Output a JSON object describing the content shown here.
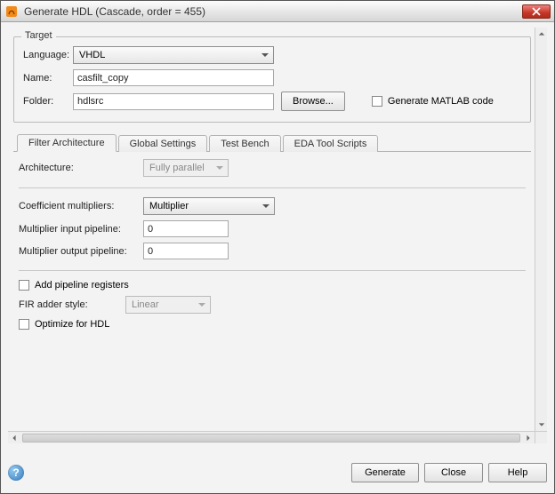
{
  "window": {
    "title": "Generate HDL (Cascade, order = 455)"
  },
  "target": {
    "legend": "Target",
    "language_label": "Language:",
    "language_value": "VHDL",
    "name_label": "Name:",
    "name_value": "casfilt_copy",
    "folder_label": "Folder:",
    "folder_value": "hdlsrc",
    "browse_label": "Browse...",
    "gen_matlab_label": "Generate MATLAB code"
  },
  "tabs": {
    "filter_arch": "Filter Architecture",
    "global_settings": "Global Settings",
    "test_bench": "Test Bench",
    "eda_scripts": "EDA Tool Scripts"
  },
  "filter_arch_panel": {
    "architecture_label": "Architecture:",
    "architecture_value": "Fully parallel",
    "coef_mult_label": "Coefficient multipliers:",
    "coef_mult_value": "Multiplier",
    "mult_in_pipe_label": "Multiplier input pipeline:",
    "mult_in_pipe_value": "0",
    "mult_out_pipe_label": "Multiplier output pipeline:",
    "mult_out_pipe_value": "0",
    "add_pipeline_label": "Add pipeline registers",
    "fir_adder_label": "FIR adder style:",
    "fir_adder_value": "Linear",
    "optimize_hdl_label": "Optimize for HDL"
  },
  "buttons": {
    "generate": "Generate",
    "close": "Close",
    "help": "Help"
  }
}
